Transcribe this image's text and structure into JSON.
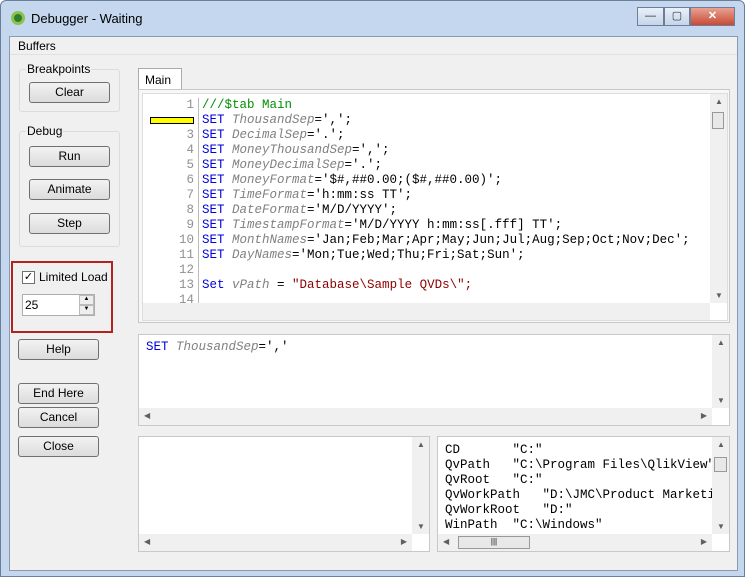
{
  "window": {
    "title": "Debugger - Waiting",
    "minimize": "—",
    "maximize": "▢",
    "close": "✕"
  },
  "menu": {
    "buffers": "Buffers"
  },
  "breakpoints": {
    "label": "Breakpoints",
    "clear": "Clear"
  },
  "debug": {
    "label": "Debug",
    "run": "Run",
    "animate": "Animate",
    "step": "Step"
  },
  "limited_load": {
    "label": "Limited Load",
    "checked": true,
    "value": "25"
  },
  "buttons": {
    "help": "Help",
    "end_here": "End Here",
    "cancel": "Cancel",
    "close": "Close"
  },
  "tabs": [
    {
      "label": "Main",
      "active": true
    }
  ],
  "editor": {
    "current_line": 2,
    "breakpoint_color": "#ffff00",
    "lines": [
      [
        [
          "cmt",
          "///$tab Main"
        ]
      ],
      [
        [
          "kw",
          "SET "
        ],
        [
          "var",
          "ThousandSep"
        ],
        [
          "str",
          "=',';"
        ]
      ],
      [
        [
          "kw",
          "SET "
        ],
        [
          "var",
          "DecimalSep"
        ],
        [
          "str",
          "='.';"
        ]
      ],
      [
        [
          "kw",
          "SET "
        ],
        [
          "var",
          "MoneyThousandSep"
        ],
        [
          "str",
          "=',';"
        ]
      ],
      [
        [
          "kw",
          "SET "
        ],
        [
          "var",
          "MoneyDecimalSep"
        ],
        [
          "str",
          "='.';"
        ]
      ],
      [
        [
          "kw",
          "SET "
        ],
        [
          "var",
          "MoneyFormat"
        ],
        [
          "str",
          "='$#,##0.00;($#,##0.00)';"
        ]
      ],
      [
        [
          "kw",
          "SET "
        ],
        [
          "var",
          "TimeFormat"
        ],
        [
          "str",
          "='h:mm:ss TT';"
        ]
      ],
      [
        [
          "kw",
          "SET "
        ],
        [
          "var",
          "DateFormat"
        ],
        [
          "str",
          "='M/D/YYYY';"
        ]
      ],
      [
        [
          "kw",
          "SET "
        ],
        [
          "var",
          "TimestampFormat"
        ],
        [
          "str",
          "='M/D/YYYY h:mm:ss[.fff] TT';"
        ]
      ],
      [
        [
          "kw",
          "SET "
        ],
        [
          "var",
          "MonthNames"
        ],
        [
          "str",
          "='Jan;Feb;Mar;Apr;May;Jun;Jul;Aug;Sep;Oct;Nov;Dec';"
        ]
      ],
      [
        [
          "kw",
          "SET "
        ],
        [
          "var",
          "DayNames"
        ],
        [
          "str",
          "='Mon;Tue;Wed;Thu;Fri;Sat;Sun';"
        ]
      ],
      [],
      [
        [
          "kw",
          "Set "
        ],
        [
          "var",
          "vPath"
        ],
        [
          "str",
          " = "
        ],
        [
          "dstr",
          "\"Database\\Sample QVDs\\\";"
        ]
      ],
      []
    ]
  },
  "statement": [
    [
      "kw",
      "SET "
    ],
    [
      "var",
      "ThousandSep"
    ],
    [
      "str",
      "=','"
    ]
  ],
  "variables": [
    {
      "name": "CD",
      "value": "\"C:\"",
      "pad": "       "
    },
    {
      "name": "QvPath",
      "value": "\"C:\\Program Files\\QlikView\"",
      "pad": "   "
    },
    {
      "name": "QvRoot",
      "value": "\"C:\"",
      "pad": "   "
    },
    {
      "name": "QvWorkPath",
      "value": "\"D:\\JMC\\Product Marketing",
      "pad": "   "
    },
    {
      "name": "QvWorkRoot",
      "value": "\"D:\"",
      "pad": "   "
    },
    {
      "name": "WinPath",
      "value": "\"C:\\Windows\"",
      "pad": "  "
    }
  ]
}
